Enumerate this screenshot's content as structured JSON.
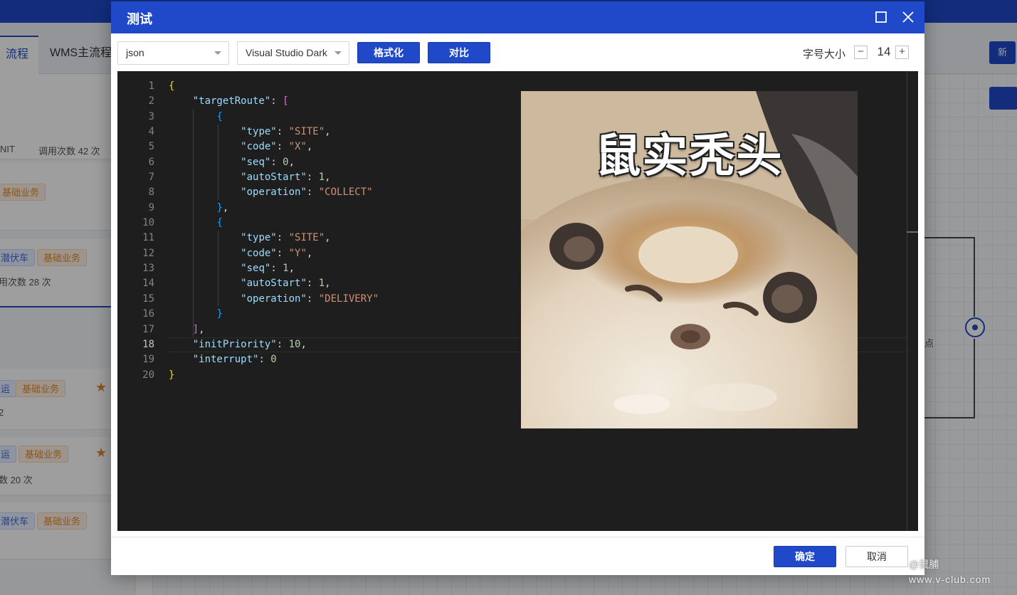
{
  "background": {
    "tabs": [
      {
        "label": "流程"
      },
      {
        "label": "WMS主流程"
      }
    ],
    "left_texts": {
      "r1_a": "NIT",
      "r1_b": "调用次数 42 次",
      "r2_stat": "用次数 28 次",
      "r3_stat": "2",
      "r4_stat": "数 20 次"
    },
    "tags": {
      "forklift": "潜伏车",
      "basic": "基础业务",
      "transport": "运"
    },
    "right_button": "新",
    "node_label": "点"
  },
  "modal": {
    "title": "测试",
    "language_select": {
      "value": "json"
    },
    "theme_select": {
      "value": "Visual Studio Dark"
    },
    "format_button": "格式化",
    "compare_button": "对比",
    "fontsize_label": "字号大小",
    "fontsize_value": "14",
    "minus": "−",
    "plus": "+",
    "ok_button": "确定",
    "cancel_button": "取消",
    "image_caption": "鼠实秃头"
  },
  "editor": {
    "line_numbers": [
      "1",
      "2",
      "3",
      "4",
      "5",
      "6",
      "7",
      "8",
      "9",
      "10",
      "11",
      "12",
      "13",
      "14",
      "15",
      "16",
      "17",
      "18",
      "19",
      "20"
    ],
    "current_line": 18,
    "tokens": {
      "targetRoute": "\"targetRoute\"",
      "type": "\"type\"",
      "code": "\"code\"",
      "seq": "\"seq\"",
      "autoStart": "\"autoStart\"",
      "operation": "\"operation\"",
      "initPriority": "\"initPriority\"",
      "interrupt": "\"interrupt\"",
      "site": "\"SITE\"",
      "code_x": "\"X\"",
      "code_y": "\"Y\"",
      "op_collect": "\"COLLECT\"",
      "op_delivery": "\"DELIVERY\"",
      "seq_0": "0",
      "seq_1": "1",
      "auto_1": "1",
      "priority_10": "10",
      "interrupt_0": "0"
    }
  },
  "watermark": {
    "line1": "@鼠脯",
    "line2": "www.v-club.com"
  }
}
